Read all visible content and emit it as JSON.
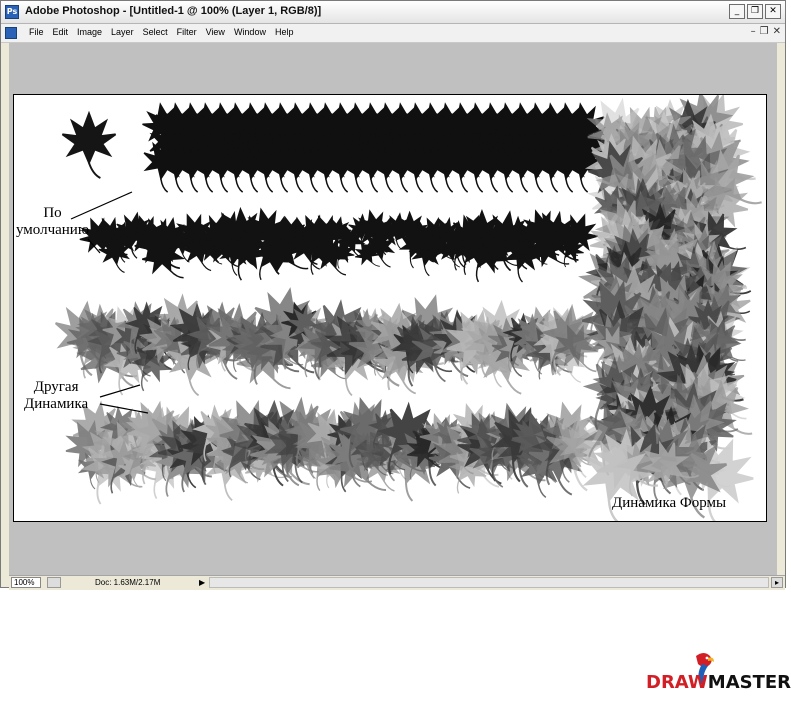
{
  "window": {
    "title": "Adobe Photoshop - [Untitled-1 @ 100% (Layer 1, RGB/8)]"
  },
  "menubar": {
    "items": [
      "File",
      "Edit",
      "Image",
      "Layer",
      "Select",
      "Filter",
      "View",
      "Window",
      "Help"
    ]
  },
  "canvas": {
    "labels": {
      "default": "По\nумолчанию",
      "other_dynamics": "Другая\nДинамика",
      "shape_dynamics": "Динамика Формы"
    }
  },
  "statusbar": {
    "zoom": "100%",
    "doc_info": "Doc: 1.63M/2.17M"
  },
  "logo": {
    "part1": "DRAW",
    "part2": "MASTER.RU"
  },
  "colors": {
    "workspace": "#c0c0c0",
    "brush": "#111111",
    "logo_red": "#d21f26"
  }
}
